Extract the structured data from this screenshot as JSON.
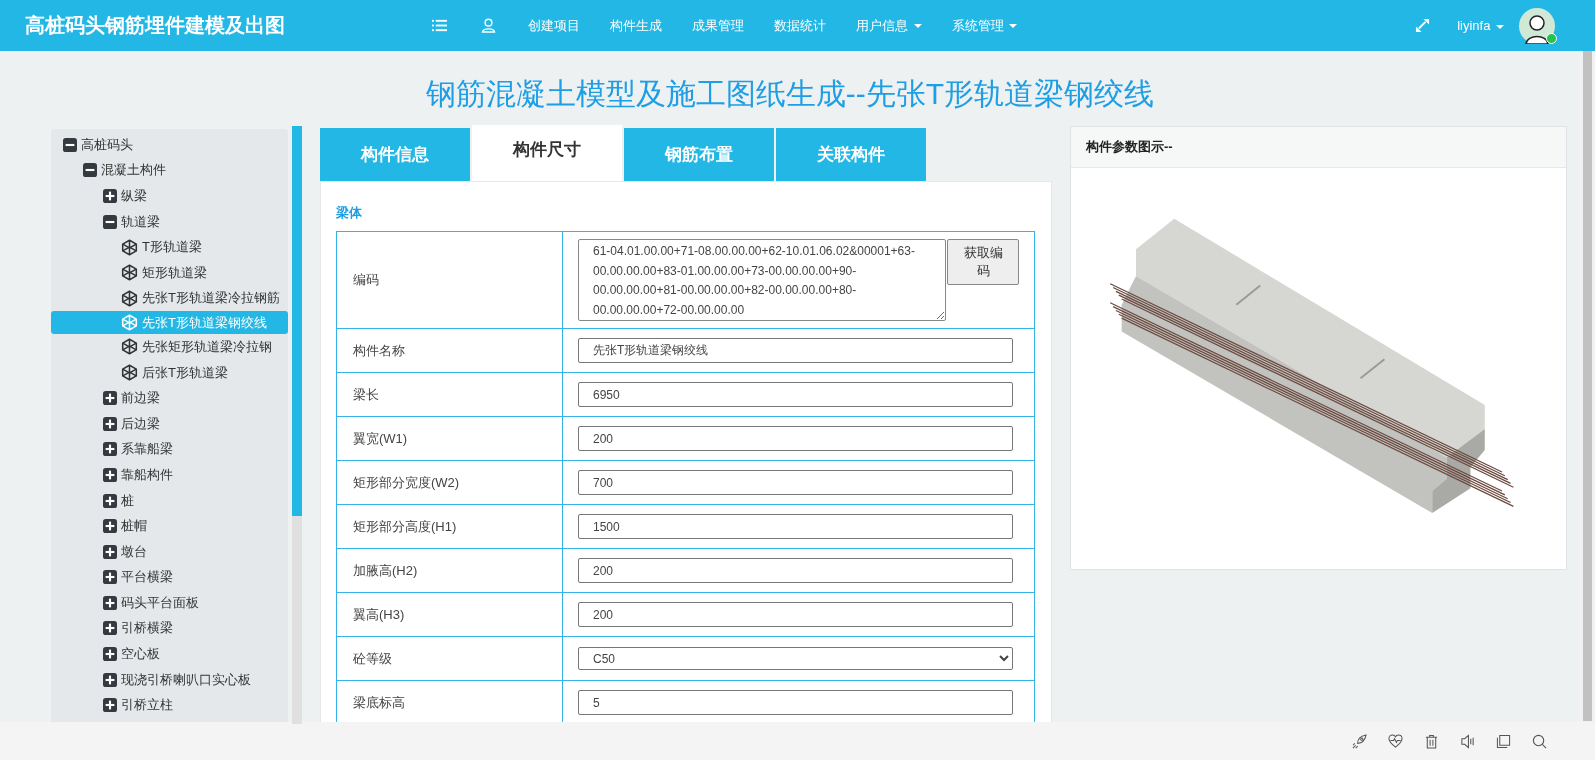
{
  "header": {
    "app_title": "高桩码头钢筋埋件建模及出图",
    "nav": [
      {
        "label": "创建项目",
        "kind": "link"
      },
      {
        "label": "构件生成",
        "kind": "link"
      },
      {
        "label": "成果管理",
        "kind": "link"
      },
      {
        "label": "数据统计",
        "kind": "link"
      },
      {
        "label": "用户信息",
        "kind": "dropdown"
      },
      {
        "label": "系统管理",
        "kind": "dropdown"
      }
    ],
    "user": {
      "name": "liyinfa",
      "online": true
    }
  },
  "page_title": "钢筋混凝土模型及施工图纸生成--先张T形轨道梁钢绞线",
  "tree": [
    {
      "label": "高桩码头",
      "kind": "branch",
      "expanded": true,
      "selected": false,
      "children": [
        {
          "label": "混凝土构件",
          "kind": "branch",
          "expanded": true,
          "selected": false,
          "children": [
            {
              "label": "纵梁",
              "kind": "branch",
              "expanded": false,
              "selected": false
            },
            {
              "label": "轨道梁",
              "kind": "branch",
              "expanded": true,
              "selected": false,
              "children": [
                {
                  "label": "T形轨道梁",
                  "kind": "leaf",
                  "selected": false
                },
                {
                  "label": "矩形轨道梁",
                  "kind": "leaf",
                  "selected": false
                },
                {
                  "label": "先张T形轨道梁冷拉钢筋",
                  "kind": "leaf",
                  "selected": false
                },
                {
                  "label": "先张T形轨道梁钢绞线",
                  "kind": "leaf",
                  "selected": true
                },
                {
                  "label": "先张矩形轨道梁冷拉钢",
                  "kind": "leaf",
                  "selected": false
                },
                {
                  "label": "后张T形轨道梁",
                  "kind": "leaf",
                  "selected": false
                }
              ]
            },
            {
              "label": "前边梁",
              "kind": "branch",
              "expanded": false,
              "selected": false
            },
            {
              "label": "后边梁",
              "kind": "branch",
              "expanded": false,
              "selected": false
            },
            {
              "label": "系靠船梁",
              "kind": "branch",
              "expanded": false,
              "selected": false
            },
            {
              "label": "靠船构件",
              "kind": "branch",
              "expanded": false,
              "selected": false
            },
            {
              "label": "桩",
              "kind": "branch",
              "expanded": false,
              "selected": false
            },
            {
              "label": "桩帽",
              "kind": "branch",
              "expanded": false,
              "selected": false
            },
            {
              "label": "墩台",
              "kind": "branch",
              "expanded": false,
              "selected": false
            },
            {
              "label": "平台横梁",
              "kind": "branch",
              "expanded": false,
              "selected": false
            },
            {
              "label": "码头平台面板",
              "kind": "branch",
              "expanded": false,
              "selected": false
            },
            {
              "label": "引桥横梁",
              "kind": "branch",
              "expanded": false,
              "selected": false
            },
            {
              "label": "空心板",
              "kind": "branch",
              "expanded": false,
              "selected": false
            },
            {
              "label": "现浇引桥喇叭口实心板",
              "kind": "branch",
              "expanded": false,
              "selected": false
            },
            {
              "label": "引桥立柱",
              "kind": "branch",
              "expanded": false,
              "selected": false
            }
          ]
        }
      ]
    }
  ],
  "tabs": [
    {
      "label": "构件信息",
      "selected": false
    },
    {
      "label": "构件尺寸",
      "selected": true
    },
    {
      "label": "钢筋布置",
      "selected": false
    },
    {
      "label": "关联构件",
      "selected": false
    }
  ],
  "form": {
    "section": "梁体",
    "rows": [
      {
        "label": "编码",
        "kind": "textarea",
        "value": "61-04.01.00.00+71-08.00.00.00+62-10.01.06.02&00001+63-00.00.00.00+83-01.00.00.00+73-00.00.00.00+90-00.00.00.00+81-00.00.00.00+82-00.00.00.00+80-00.00.00.00+72-00.00.00.00",
        "button": "获取编码"
      },
      {
        "label": "构件名称",
        "kind": "input",
        "value": "先张T形轨道梁钢绞线"
      },
      {
        "label": "梁长",
        "kind": "input",
        "value": "6950"
      },
      {
        "label": "翼宽(W1)",
        "kind": "input",
        "value": "200"
      },
      {
        "label": "矩形部分宽度(W2)",
        "kind": "input",
        "value": "700"
      },
      {
        "label": "矩形部分高度(H1)",
        "kind": "input",
        "value": "1500"
      },
      {
        "label": "加腋高(H2)",
        "kind": "input",
        "value": "200"
      },
      {
        "label": "翼高(H3)",
        "kind": "input",
        "value": "200"
      },
      {
        "label": "砼等级",
        "kind": "select",
        "value": "C50"
      },
      {
        "label": "梁底标高",
        "kind": "input",
        "value": "5"
      }
    ]
  },
  "preview": {
    "title": "构件参数图示--"
  }
}
